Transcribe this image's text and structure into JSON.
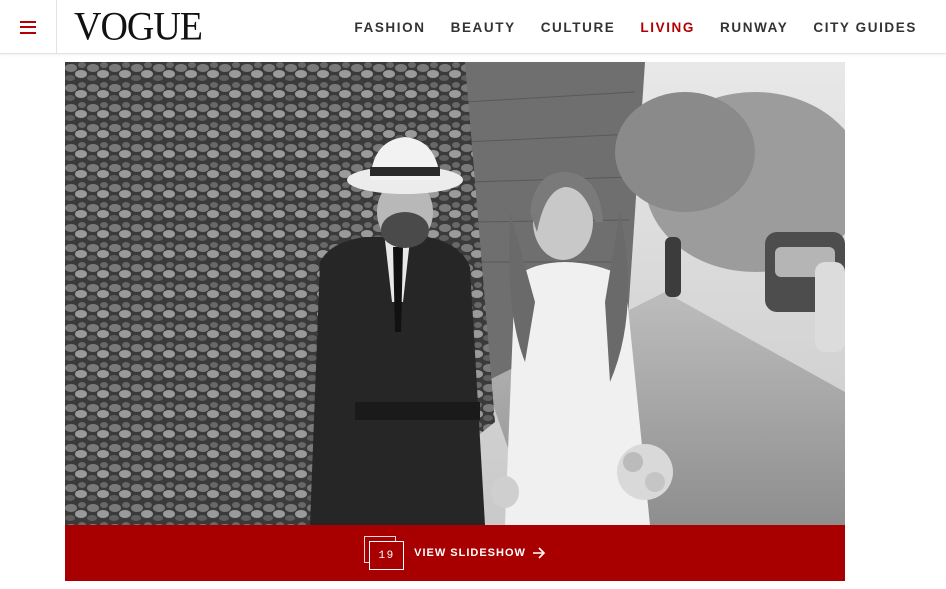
{
  "header": {
    "logo": "VOGUE",
    "menu_icon": "hamburger-menu-icon",
    "nav": [
      {
        "label": "FASHION",
        "active": false
      },
      {
        "label": "BEAUTY",
        "active": false
      },
      {
        "label": "CULTURE",
        "active": false
      },
      {
        "label": "LIVING",
        "active": true
      },
      {
        "label": "RUNWAY",
        "active": false
      },
      {
        "label": "CITY GUIDES",
        "active": false
      }
    ]
  },
  "hero": {
    "description_icon": "wedding-photo"
  },
  "slideshow": {
    "count": "19",
    "label": "VIEW SLIDESHOW",
    "icon": "arrow-right-icon"
  },
  "colors": {
    "accent": "#a80000",
    "nav_text": "#333333",
    "nav_active": "#b30000"
  }
}
